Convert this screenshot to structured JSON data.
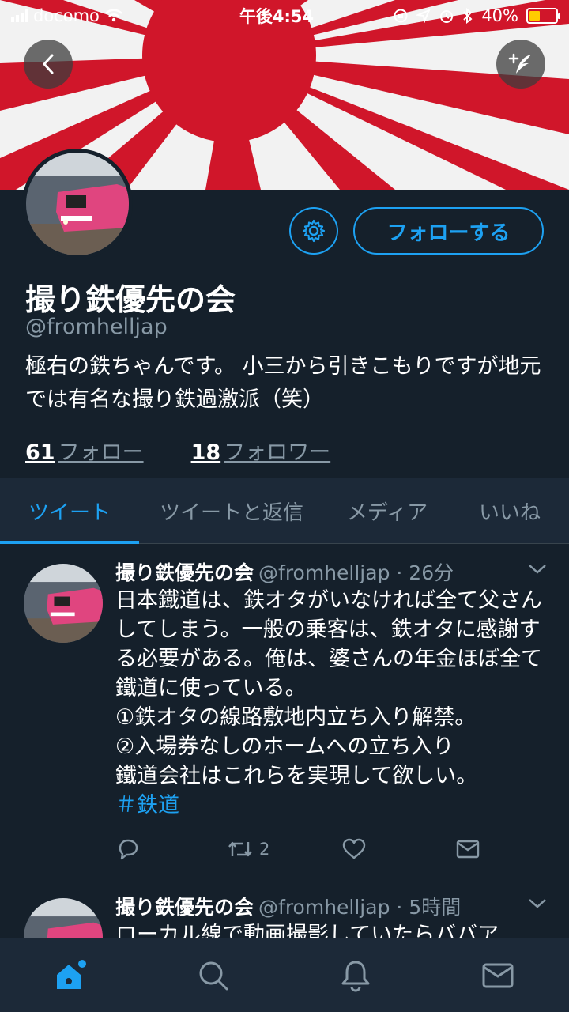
{
  "status_bar": {
    "carrier": "docomo",
    "time": "午後4:54",
    "battery": "40%",
    "battery_level": 0.4
  },
  "header": {
    "banner_image": "rising-sun-flag",
    "back_icon": "chevron-left-icon",
    "compose_icon": "compose-tweet-icon"
  },
  "profile": {
    "display_name": "撮り鉄優先の会",
    "handle": "@fromhelljap",
    "bio": "極右の鉄ちゃんです。 小三から引きこもりですが地元では有名な撮り鉄過激派（笑）",
    "following_count": "61",
    "following_label": "フォロー",
    "followers_count": "18",
    "followers_label": "フォロワー",
    "follow_button": "フォローする",
    "settings_icon": "gear-icon"
  },
  "tabs": [
    {
      "label": "ツイート",
      "active": true
    },
    {
      "label": "ツイートと返信",
      "active": false
    },
    {
      "label": "メディア",
      "active": false
    },
    {
      "label": "いいね",
      "active": false
    }
  ],
  "tweets": [
    {
      "name": "撮り鉄優先の会",
      "handle_time": "@fromhelljap · 26分",
      "text": "日本鐡道は、鉄オタがいなければ全て父さんしてしまう。一般の乗客は、鉄オタに感謝する必要がある。俺は、婆さんの年金ほぼ全て鐵道に使っている。\n①鉄オタの線路敷地内立ち入り解禁。\n②入場券なしのホームへの立ち入り\n鐵道会社はこれらを実現して欲しい。",
      "hashtag": "＃鉄道",
      "retweets": "2"
    },
    {
      "name": "撮り鉄優先の会",
      "handle_time": "@fromhelljap · 5時間",
      "text": "ローカル線で動画撮影していたらババア"
    }
  ],
  "bottom_nav": [
    {
      "icon": "home-icon",
      "active": true
    },
    {
      "icon": "search-icon",
      "active": false
    },
    {
      "icon": "bell-icon",
      "active": false
    },
    {
      "icon": "mail-icon",
      "active": false
    }
  ],
  "colors": {
    "background": "#15202b",
    "accent": "#1da1f2",
    "muted": "#8899a6",
    "banner_red": "#d0162a"
  }
}
